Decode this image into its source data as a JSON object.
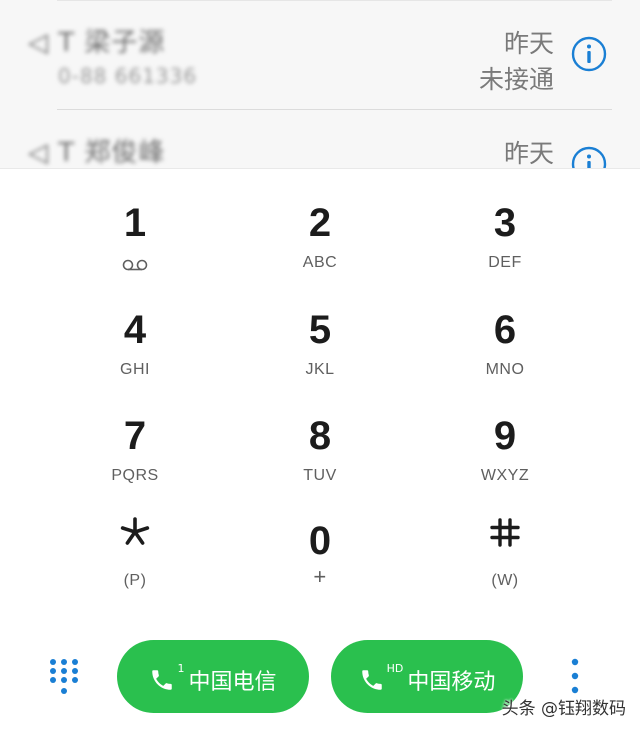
{
  "call_log": [
    {
      "name": "◁ T 梁子源",
      "number": "0-88 661336",
      "date": "昨天",
      "status": "未接通"
    },
    {
      "name": "◁ T 郑俊峰",
      "number": "",
      "date": "昨天",
      "status": ""
    }
  ],
  "dialpad": {
    "keys": [
      {
        "digit": "1",
        "letters": "",
        "icon": "voicemail-icon"
      },
      {
        "digit": "2",
        "letters": "ABC"
      },
      {
        "digit": "3",
        "letters": "DEF"
      },
      {
        "digit": "4",
        "letters": "GHI"
      },
      {
        "digit": "5",
        "letters": "JKL"
      },
      {
        "digit": "6",
        "letters": "MNO"
      },
      {
        "digit": "7",
        "letters": "PQRS"
      },
      {
        "digit": "8",
        "letters": "TUV"
      },
      {
        "digit": "9",
        "letters": "WXYZ"
      },
      {
        "digit": "*",
        "letters": "(P)",
        "icon": "asterisk-icon"
      },
      {
        "digit": "0",
        "letters": "+"
      },
      {
        "digit": "#",
        "letters": "(W)",
        "icon": "hash-icon"
      }
    ]
  },
  "bottom_bar": {
    "sim1": {
      "label": "中国电信",
      "badge": "1"
    },
    "sim2": {
      "label": "中国移动",
      "badge": "HD"
    }
  },
  "watermark": "头条 @钰翔数码",
  "colors": {
    "call_button": "#2ac04e",
    "accent_blue": "#1a7fd4",
    "text_primary": "#1c1c1c",
    "text_secondary": "#7a7a7a"
  }
}
